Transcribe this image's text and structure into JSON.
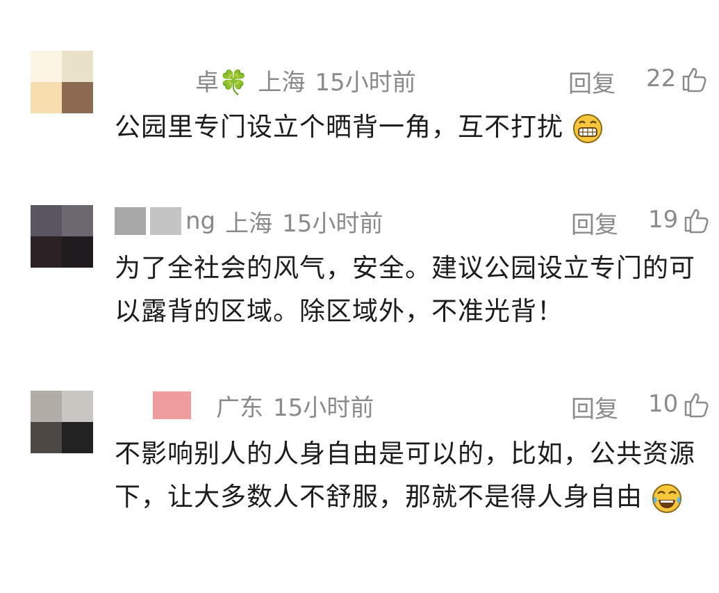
{
  "comments": [
    {
      "name_tail": "卓🍀",
      "location": "上海",
      "time": "15小时前",
      "reply_label": "回复",
      "likes": "22",
      "text": "公园里专门设立个晒背一角，互不打扰",
      "emoji": "grin-emoji-icon",
      "avatar_colors": [
        "#fdf5e3",
        "#e9e1c8",
        "#f7deae",
        "#8c6a52"
      ]
    },
    {
      "name_tail": "ng",
      "location": "上海",
      "time": "15小时前",
      "reply_label": "回复",
      "likes": "19",
      "text": "为了全社会的风气，安全。建议公园设立专门的可以露背的区域。除区域外，不准光背！",
      "avatar_colors": [
        "#5b5560",
        "#6d6870",
        "#2c2125",
        "#201b1f"
      ]
    },
    {
      "name_tail": "",
      "location": "广东",
      "time": "15小时前",
      "reply_label": "回复",
      "likes": "10",
      "text": "不影响别人的人身自由是可以的，比如，公共资源下，让大多数人不舒服，那就不是得人身自由",
      "emoji": "tears-of-joy-emoji-icon",
      "avatar_colors": [
        "#b2aca7",
        "#c9c5c1",
        "#4e4844",
        "#222222"
      ]
    }
  ],
  "colors": {
    "meta_text": "#8a8a8a",
    "body_text": "#1c1c1c"
  }
}
